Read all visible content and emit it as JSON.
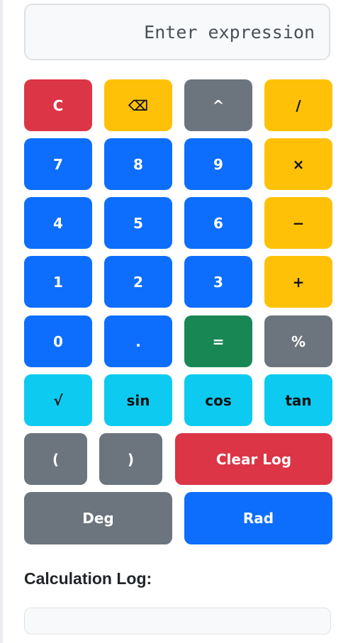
{
  "display": {
    "placeholder": "Enter expression",
    "value": ""
  },
  "buttons": {
    "clear": "C",
    "backspace": "⌫",
    "power": "^",
    "divide": "/",
    "seven": "7",
    "eight": "8",
    "nine": "9",
    "multiply": "×",
    "four": "4",
    "five": "5",
    "six": "6",
    "subtract": "−",
    "one": "1",
    "two": "2",
    "three": "3",
    "add": "+",
    "zero": "0",
    "decimal": ".",
    "equals": "=",
    "percent": "%",
    "sqrt": "√",
    "sin": "sin",
    "cos": "cos",
    "tan": "tan",
    "open_paren": "(",
    "close_paren": ")",
    "clear_log": "Clear Log",
    "deg": "Deg",
    "rad": "Rad"
  },
  "log": {
    "title": "Calculation Log:",
    "entries": []
  },
  "colors": {
    "danger": "#dc3545",
    "warning": "#ffc107",
    "secondary": "#6c757d",
    "primary": "#0d6efd",
    "success": "#198754",
    "info": "#0dcaf0"
  }
}
